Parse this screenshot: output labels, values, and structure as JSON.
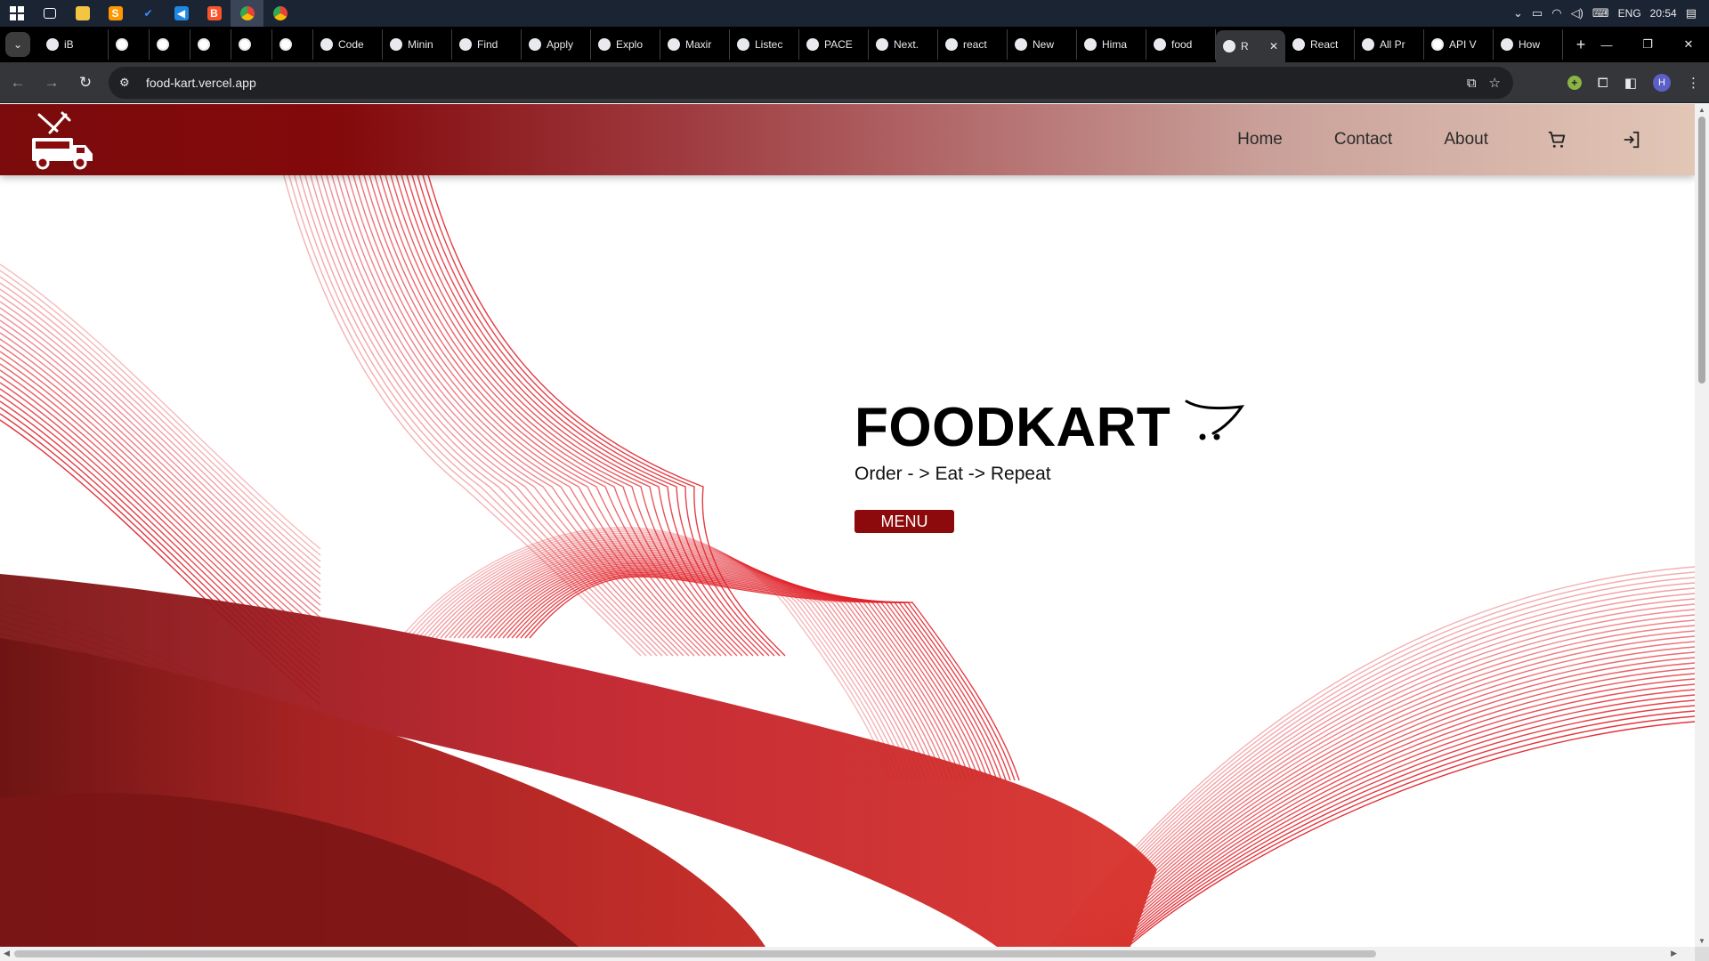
{
  "taskbar": {
    "apps": [
      "windows-start",
      "task-view",
      "file-explorer",
      "sublime-text",
      "todo-app",
      "vs-code",
      "brave-browser",
      "chrome-browser",
      "chrome-browser-2"
    ],
    "tray": {
      "language": "ENG",
      "time": "20:54"
    }
  },
  "browser": {
    "tabs": [
      {
        "label": "iB",
        "icon": "text-icon"
      },
      {
        "label": "",
        "icon": "github-icon"
      },
      {
        "label": "",
        "icon": "github-icon"
      },
      {
        "label": "",
        "icon": "github-icon"
      },
      {
        "label": "",
        "icon": "github-icon"
      },
      {
        "label": "",
        "icon": "github-icon"
      },
      {
        "label": "Code",
        "icon": "chart-icon"
      },
      {
        "label": "Minin",
        "icon": "codeforces-icon"
      },
      {
        "label": "Find",
        "icon": "codeforces-icon"
      },
      {
        "label": "Apply",
        "icon": "codeforces-icon"
      },
      {
        "label": "Explo",
        "icon": "site-icon"
      },
      {
        "label": "Maxir",
        "icon": "globe-icon"
      },
      {
        "label": "Listec",
        "icon": "gmail-icon"
      },
      {
        "label": "PACE",
        "icon": "globe-icon"
      },
      {
        "label": "Next.",
        "icon": "globe-icon"
      },
      {
        "label": "react",
        "icon": "globe-icon"
      },
      {
        "label": "New",
        "icon": "chrome-icon"
      },
      {
        "label": "Hima",
        "icon": "h-icon"
      },
      {
        "label": "food",
        "icon": "vercel-icon"
      },
      {
        "label": "R",
        "icon": "react-icon",
        "active": true
      },
      {
        "label": "React",
        "icon": "react-icon"
      },
      {
        "label": "All Pr",
        "icon": "react-icon"
      },
      {
        "label": "API V",
        "icon": "github-icon"
      },
      {
        "label": "How",
        "icon": "stackoverflow-icon"
      }
    ],
    "url": "food-kart.vercel.app"
  },
  "page": {
    "nav": {
      "home": "Home",
      "contact": "Contact",
      "about": "About"
    },
    "hero": {
      "title": "FOODKART",
      "tagline": "Order - > Eat -> Repeat",
      "menu_button": "MENU"
    }
  },
  "colors": {
    "brand_dark": "#7b0b0c",
    "brand_light": "#e2c6b6",
    "wave_red": "#e0232b",
    "menu_button": "#8c0a0b"
  }
}
